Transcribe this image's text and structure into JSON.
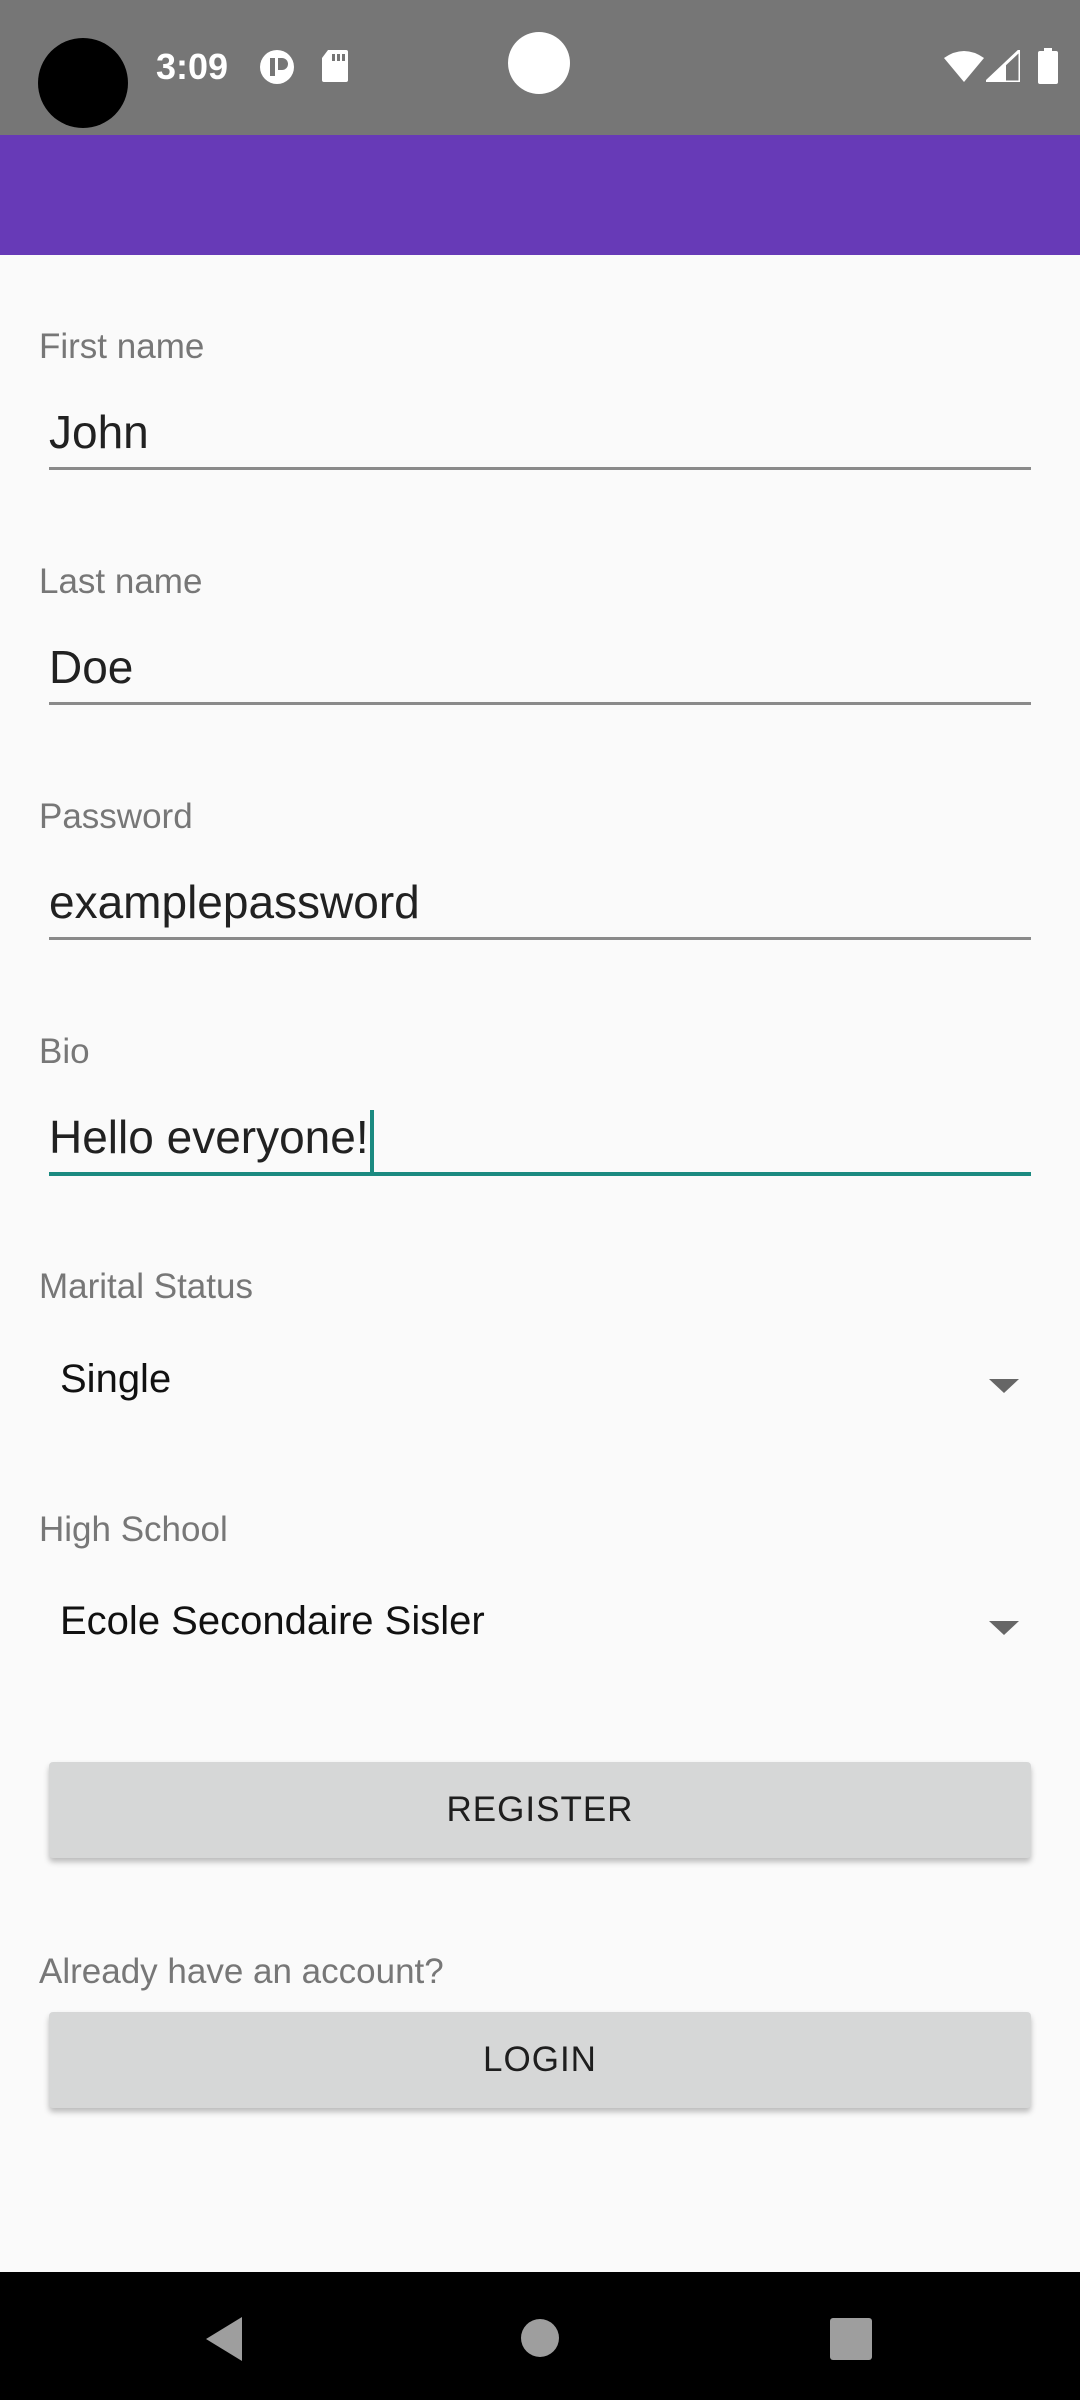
{
  "status_bar": {
    "time": "3:09",
    "background_color": "#767676",
    "icons": [
      "camera-hole",
      "nfc-icon",
      "sd-card-icon",
      "wifi-icon",
      "signal-icon",
      "battery-icon"
    ]
  },
  "app_bar": {
    "background_color": "#673ab7"
  },
  "form": {
    "first_name": {
      "label": "First name",
      "value": "John"
    },
    "last_name": {
      "label": "Last name",
      "value": "Doe"
    },
    "password": {
      "label": "Password",
      "value": "examplepassword"
    },
    "bio": {
      "label": "Bio",
      "value": "Hello everyone!"
    },
    "marital_status": {
      "label": "Marital Status",
      "value": "Single"
    },
    "high_school": {
      "label": "High School",
      "value": "Ecole Secondaire Sisler"
    },
    "register_button": "REGISTER",
    "login_prompt": "Already have an account?",
    "login_button": "LOGIN"
  },
  "nav_bar": {
    "icons": [
      "back-icon",
      "home-icon",
      "recents-icon"
    ]
  }
}
